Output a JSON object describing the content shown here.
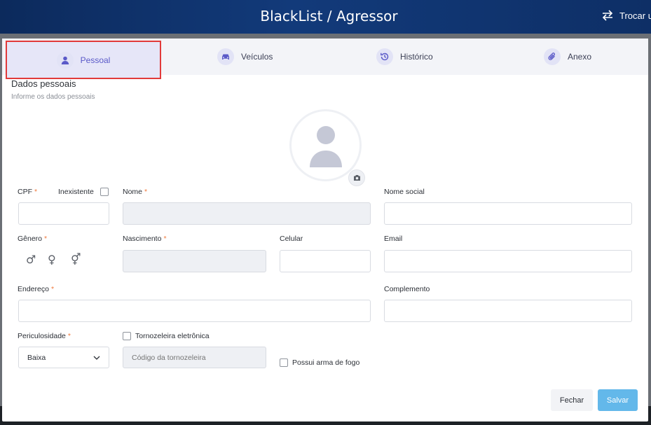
{
  "header": {
    "title": "BlackList / Agressor",
    "switch_label": "Trocar u"
  },
  "tabs": [
    {
      "label": "Pessoal",
      "icon": "user-icon",
      "active": true
    },
    {
      "label": "Veículos",
      "icon": "car-icon",
      "active": false
    },
    {
      "label": "Histórico",
      "icon": "history-icon",
      "active": false
    },
    {
      "label": "Anexo",
      "icon": "paperclip-icon",
      "active": false
    }
  ],
  "section": {
    "title": "Dados pessoais",
    "subtitle": "Informe os dados pessoais"
  },
  "fields": {
    "cpf": {
      "label": "CPF",
      "required_mark": "*",
      "value": ""
    },
    "inexistente": {
      "label": "Inexistente",
      "checked": false
    },
    "nome": {
      "label": "Nome",
      "required_mark": "*",
      "value": ""
    },
    "nome_social": {
      "label": "Nome social",
      "value": ""
    },
    "genero": {
      "label": "Gênero",
      "required_mark": "*",
      "options": [
        "♂",
        "♀",
        "⚥"
      ]
    },
    "nascimento": {
      "label": "Nascimento",
      "required_mark": "*",
      "value": ""
    },
    "celular": {
      "label": "Celular",
      "value": ""
    },
    "email": {
      "label": "Email",
      "value": ""
    },
    "endereco": {
      "label": "Endereço",
      "required_mark": "*",
      "value": ""
    },
    "complemento": {
      "label": "Complemento",
      "value": ""
    },
    "periculosidade": {
      "label": "Periculosidade",
      "required_mark": "*",
      "selected": "Baixa"
    },
    "tornozeleira": {
      "label": "Tornozeleira eletrônica",
      "checked": false,
      "placeholder": "Código da tornozeleira"
    },
    "arma": {
      "label": "Possui arma de fogo",
      "checked": false
    }
  },
  "buttons": {
    "close": "Fechar",
    "save": "Salvar"
  },
  "colors": {
    "accent": "#5a59c8",
    "required": "#f07b3f",
    "save_button": "#63b8ea",
    "header_bg": "#0e2f66"
  }
}
